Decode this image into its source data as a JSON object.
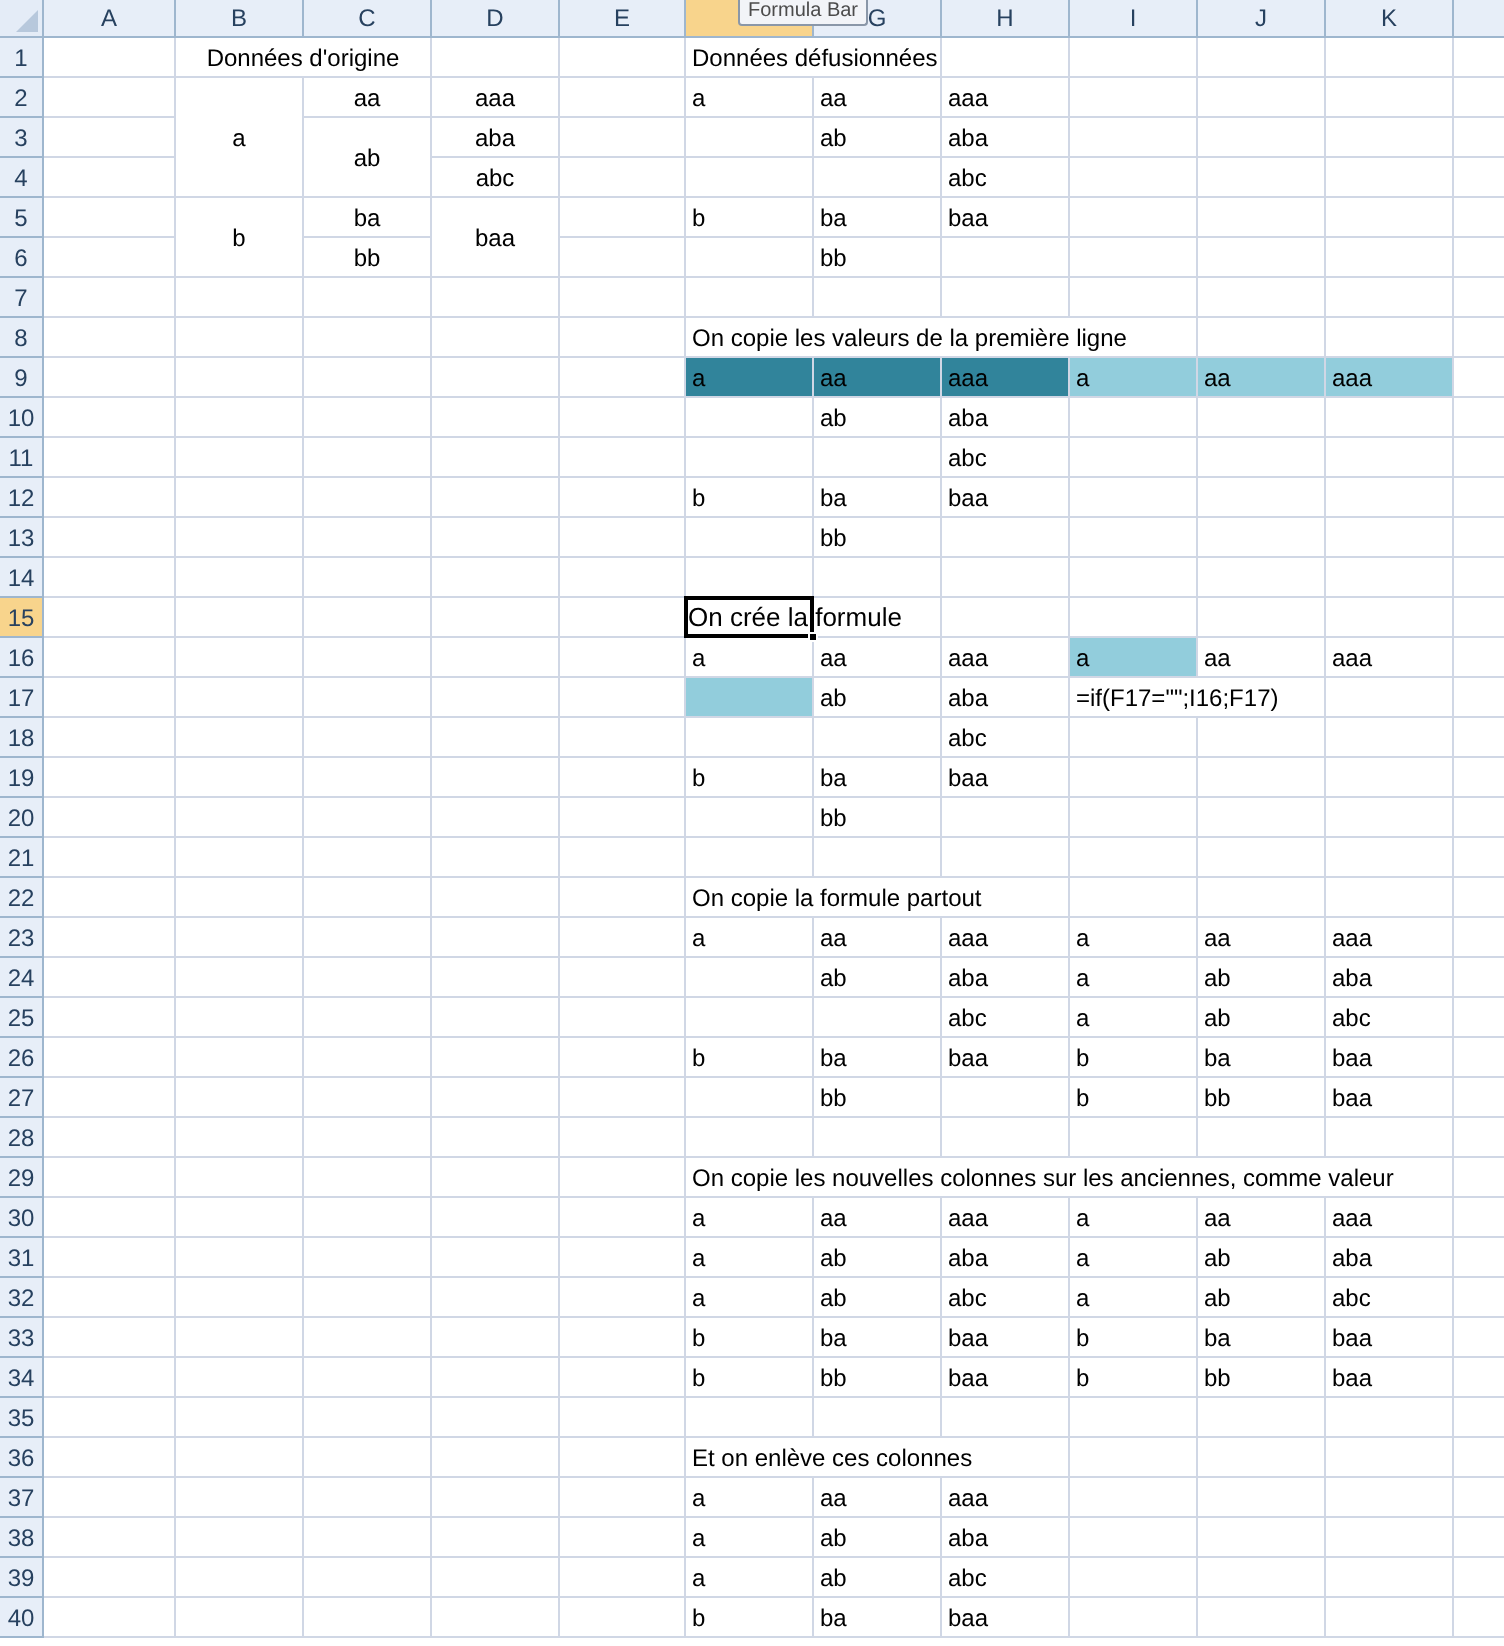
{
  "tooltip": "Formula Bar",
  "columns": [
    {
      "label": "A",
      "selected": false
    },
    {
      "label": "B",
      "selected": false
    },
    {
      "label": "C",
      "selected": false
    },
    {
      "label": "D",
      "selected": false
    },
    {
      "label": "E",
      "selected": false
    },
    {
      "selected": true
    },
    {
      "label": "G",
      "selected": false
    },
    {
      "label": "H",
      "selected": false
    },
    {
      "label": "I",
      "selected": false
    },
    {
      "label": "J",
      "selected": false
    },
    {
      "label": "K",
      "selected": false
    }
  ],
  "rows": [
    {
      "number": "1",
      "selected": false,
      "cells": [
        {},
        {
          "text": "Données d'origine",
          "centered": true,
          "merged_right": true
        },
        {},
        {},
        {},
        {
          "text": "Données défusionnées",
          "merged_right": true
        },
        {},
        {},
        {},
        {},
        {}
      ]
    },
    {
      "number": "2",
      "selected": false,
      "cells": [
        {},
        {
          "text": "a",
          "centered": true,
          "merged_down": true
        },
        {
          "text": "aa",
          "centered": true
        },
        {
          "text": "aaa",
          "centered": true
        },
        {},
        {
          "text": "a"
        },
        {
          "text": "aa"
        },
        {
          "text": "aaa"
        },
        {},
        {},
        {}
      ]
    },
    {
      "number": "3",
      "selected": false,
      "cells": [
        {},
        {
          "merged_down": true
        },
        {
          "text": "ab",
          "centered": true,
          "merged_down": true
        },
        {
          "text": "aba",
          "centered": true
        },
        {},
        {},
        {
          "text": "ab"
        },
        {
          "text": "aba"
        },
        {},
        {},
        {}
      ]
    },
    {
      "number": "4",
      "selected": false,
      "cells": [
        {},
        {},
        {},
        {
          "text": "abc",
          "centered": true
        },
        {},
        {},
        {},
        {
          "text": "abc"
        },
        {},
        {},
        {}
      ]
    },
    {
      "number": "5",
      "selected": false,
      "cells": [
        {},
        {
          "text": "b",
          "centered": true,
          "merged_down": true
        },
        {
          "text": "ba",
          "centered": true
        },
        {
          "text": "baa",
          "centered": true,
          "merged_down": true
        },
        {},
        {
          "text": "b"
        },
        {
          "text": "ba"
        },
        {
          "text": "baa"
        },
        {},
        {},
        {}
      ]
    },
    {
      "number": "6",
      "selected": false,
      "cells": [
        {},
        {},
        {
          "text": "bb",
          "centered": true
        },
        {},
        {},
        {},
        {
          "text": "bb"
        },
        {},
        {},
        {},
        {}
      ]
    },
    {
      "number": "7",
      "selected": false,
      "cells": [
        {},
        {},
        {},
        {},
        {},
        {},
        {},
        {},
        {},
        {},
        {}
      ]
    },
    {
      "number": "8",
      "selected": false,
      "cells": [
        {},
        {},
        {},
        {},
        {},
        {
          "text": "On copie les valeurs de la première ligne",
          "merged_right": true
        },
        {
          "merged_right": true
        },
        {
          "merged_right": true
        },
        {},
        {},
        {}
      ]
    },
    {
      "number": "9",
      "selected": false,
      "cells": [
        {},
        {},
        {},
        {},
        {},
        {
          "text": "a",
          "color": "#31849b"
        },
        {
          "text": "aa",
          "color": "#31849b"
        },
        {
          "text": "aaa",
          "color": "#31849b"
        },
        {
          "text": "a",
          "color": "#92cddc"
        },
        {
          "text": "aa",
          "color": "#92cddc"
        },
        {
          "text": "aaa",
          "color": "#92cddc"
        }
      ]
    },
    {
      "number": "10",
      "selected": false,
      "cells": [
        {},
        {},
        {},
        {},
        {},
        {},
        {
          "text": "ab"
        },
        {
          "text": "aba"
        },
        {},
        {},
        {}
      ]
    },
    {
      "number": "11",
      "selected": false,
      "cells": [
        {},
        {},
        {},
        {},
        {},
        {},
        {},
        {
          "text": "abc"
        },
        {},
        {},
        {}
      ]
    },
    {
      "number": "12",
      "selected": false,
      "cells": [
        {},
        {},
        {},
        {},
        {},
        {
          "text": "b"
        },
        {
          "text": "ba"
        },
        {
          "text": "baa"
        },
        {},
        {},
        {}
      ]
    },
    {
      "number": "13",
      "selected": false,
      "cells": [
        {},
        {},
        {},
        {},
        {},
        {},
        {
          "text": "bb"
        },
        {},
        {},
        {},
        {}
      ]
    },
    {
      "number": "14",
      "selected": false,
      "cells": [
        {},
        {},
        {},
        {},
        {},
        {},
        {},
        {},
        {},
        {},
        {}
      ]
    },
    {
      "number": "15",
      "selected": true,
      "cells": [
        {},
        {},
        {},
        {},
        {},
        {
          "text": "On crée la formule",
          "merged_right": true,
          "selected": true
        },
        {},
        {},
        {},
        {},
        {}
      ]
    },
    {
      "number": "16",
      "selected": false,
      "cells": [
        {},
        {},
        {},
        {},
        {},
        {
          "text": "a"
        },
        {
          "text": "aa"
        },
        {
          "text": "aaa"
        },
        {
          "text": "a",
          "color": "#92cddc"
        },
        {
          "text": "aa"
        },
        {
          "text": "aaa"
        }
      ]
    },
    {
      "number": "17",
      "selected": false,
      "cells": [
        {},
        {},
        {},
        {},
        {},
        {
          "color": "#92cddc"
        },
        {
          "text": "ab"
        },
        {
          "text": "aba"
        },
        {
          "text": "=if(F17=\"\";I16;F17)",
          "merged_right": true
        },
        {},
        {}
      ]
    },
    {
      "number": "18",
      "selected": false,
      "cells": [
        {},
        {},
        {},
        {},
        {},
        {},
        {},
        {
          "text": "abc"
        },
        {},
        {},
        {}
      ]
    },
    {
      "number": "19",
      "selected": false,
      "cells": [
        {},
        {},
        {},
        {},
        {},
        {
          "text": "b"
        },
        {
          "text": "ba"
        },
        {
          "text": "baa"
        },
        {},
        {},
        {}
      ]
    },
    {
      "number": "20",
      "selected": false,
      "cells": [
        {},
        {},
        {},
        {},
        {},
        {},
        {
          "text": "bb"
        },
        {},
        {},
        {},
        {}
      ]
    },
    {
      "number": "21",
      "selected": false,
      "cells": [
        {},
        {},
        {},
        {},
        {},
        {},
        {},
        {},
        {},
        {},
        {}
      ]
    },
    {
      "number": "22",
      "selected": false,
      "cells": [
        {},
        {},
        {},
        {},
        {},
        {
          "text": "On copie la formule partout",
          "merged_right": true
        },
        {
          "merged_right": true
        },
        {},
        {},
        {},
        {}
      ]
    },
    {
      "number": "23",
      "selected": false,
      "cells": [
        {},
        {},
        {},
        {},
        {},
        {
          "text": "a"
        },
        {
          "text": "aa"
        },
        {
          "text": "aaa"
        },
        {
          "text": "a"
        },
        {
          "text": "aa"
        },
        {
          "text": "aaa"
        }
      ]
    },
    {
      "number": "24",
      "selected": false,
      "cells": [
        {},
        {},
        {},
        {},
        {},
        {},
        {
          "text": "ab"
        },
        {
          "text": "aba"
        },
        {
          "text": "a"
        },
        {
          "text": "ab"
        },
        {
          "text": "aba"
        }
      ]
    },
    {
      "number": "25",
      "selected": false,
      "cells": [
        {},
        {},
        {},
        {},
        {},
        {},
        {},
        {
          "text": "abc"
        },
        {
          "text": "a"
        },
        {
          "text": "ab"
        },
        {
          "text": "abc"
        }
      ]
    },
    {
      "number": "26",
      "selected": false,
      "cells": [
        {},
        {},
        {},
        {},
        {},
        {
          "text": "b"
        },
        {
          "text": "ba"
        },
        {
          "text": "baa"
        },
        {
          "text": "b"
        },
        {
          "text": "ba"
        },
        {
          "text": "baa"
        }
      ]
    },
    {
      "number": "27",
      "selected": false,
      "cells": [
        {},
        {},
        {},
        {},
        {},
        {},
        {
          "text": "bb"
        },
        {},
        {
          "text": "b"
        },
        {
          "text": "bb"
        },
        {
          "text": "baa"
        }
      ]
    },
    {
      "number": "28",
      "selected": false,
      "cells": [
        {},
        {},
        {},
        {},
        {},
        {},
        {},
        {},
        {},
        {},
        {}
      ]
    },
    {
      "number": "29",
      "selected": false,
      "cells": [
        {},
        {},
        {},
        {},
        {},
        {
          "text": "On copie les nouvelles colonnes sur les anciennes, comme valeur",
          "merged_right": true
        },
        {
          "merged_right": true
        },
        {
          "merged_right": true
        },
        {
          "merged_right": true
        },
        {
          "merged_right": true
        },
        {}
      ]
    },
    {
      "number": "30",
      "selected": false,
      "cells": [
        {},
        {},
        {},
        {},
        {},
        {
          "text": "a"
        },
        {
          "text": "aa"
        },
        {
          "text": "aaa"
        },
        {
          "text": "a"
        },
        {
          "text": "aa"
        },
        {
          "text": "aaa"
        }
      ]
    },
    {
      "number": "31",
      "selected": false,
      "cells": [
        {},
        {},
        {},
        {},
        {},
        {
          "text": "a"
        },
        {
          "text": "ab"
        },
        {
          "text": "aba"
        },
        {
          "text": "a"
        },
        {
          "text": "ab"
        },
        {
          "text": "aba"
        }
      ]
    },
    {
      "number": "32",
      "selected": false,
      "cells": [
        {},
        {},
        {},
        {},
        {},
        {
          "text": "a"
        },
        {
          "text": "ab"
        },
        {
          "text": "abc"
        },
        {
          "text": "a"
        },
        {
          "text": "ab"
        },
        {
          "text": "abc"
        }
      ]
    },
    {
      "number": "33",
      "selected": false,
      "cells": [
        {},
        {},
        {},
        {},
        {},
        {
          "text": "b"
        },
        {
          "text": "ba"
        },
        {
          "text": "baa"
        },
        {
          "text": "b"
        },
        {
          "text": "ba"
        },
        {
          "text": "baa"
        }
      ]
    },
    {
      "number": "34",
      "selected": false,
      "cells": [
        {},
        {},
        {},
        {},
        {},
        {
          "text": "b"
        },
        {
          "text": "bb"
        },
        {
          "text": "baa"
        },
        {
          "text": "b"
        },
        {
          "text": "bb"
        },
        {
          "text": "baa"
        }
      ]
    },
    {
      "number": "35",
      "selected": false,
      "cells": [
        {},
        {},
        {},
        {},
        {},
        {},
        {},
        {},
        {},
        {},
        {}
      ]
    },
    {
      "number": "36",
      "selected": false,
      "cells": [
        {},
        {},
        {},
        {},
        {},
        {
          "text": "Et on enlève ces colonnes",
          "merged_right": true
        },
        {
          "merged_right": true
        },
        {},
        {},
        {},
        {}
      ]
    },
    {
      "number": "37",
      "selected": false,
      "cells": [
        {},
        {},
        {},
        {},
        {},
        {
          "text": "a"
        },
        {
          "text": "aa"
        },
        {
          "text": "aaa"
        },
        {},
        {},
        {}
      ]
    },
    {
      "number": "38",
      "selected": false,
      "cells": [
        {},
        {},
        {},
        {},
        {},
        {
          "text": "a"
        },
        {
          "text": "ab"
        },
        {
          "text": "aba"
        },
        {},
        {},
        {}
      ]
    },
    {
      "number": "39",
      "selected": false,
      "cells": [
        {},
        {},
        {},
        {},
        {},
        {
          "text": "a"
        },
        {
          "text": "ab"
        },
        {
          "text": "abc"
        },
        {},
        {},
        {}
      ]
    },
    {
      "number": "40",
      "selected": false,
      "cells": [
        {},
        {},
        {},
        {},
        {},
        {
          "text": "b"
        },
        {
          "text": "ba"
        },
        {
          "text": "baa"
        },
        {},
        {},
        {}
      ]
    }
  ]
}
